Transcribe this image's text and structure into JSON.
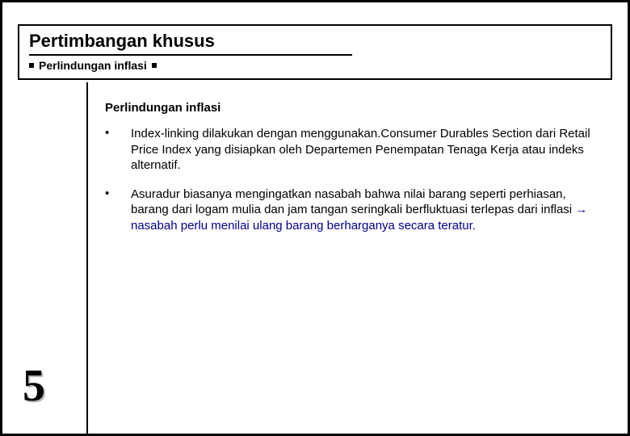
{
  "header": {
    "title": "Pertimbangan khusus",
    "subtitle": "Perlindungan inflasi"
  },
  "content": {
    "heading": "Perlindungan inflasi",
    "bullets": [
      {
        "text_plain": "Index-linking dilakukan dengan menggunakan.Consumer Durables Section dari Retail Price Index yang disiapkan oleh Departemen Penempatan Tenaga Kerja atau indeks alternatif."
      },
      {
        "text_before": "Asuradur biasanya mengingatkan nasabah bahwa nilai barang seperti perhiasan, barang dari logam mulia dan jam tangan seringkali berfluktuasi terlepas dari inflasi ",
        "arrow": "→",
        "text_emph": " nasabah perlu menilai ulang barang berharganya secara teratur."
      }
    ]
  },
  "page_number": "5",
  "colors": {
    "emphasis": "#000090"
  }
}
